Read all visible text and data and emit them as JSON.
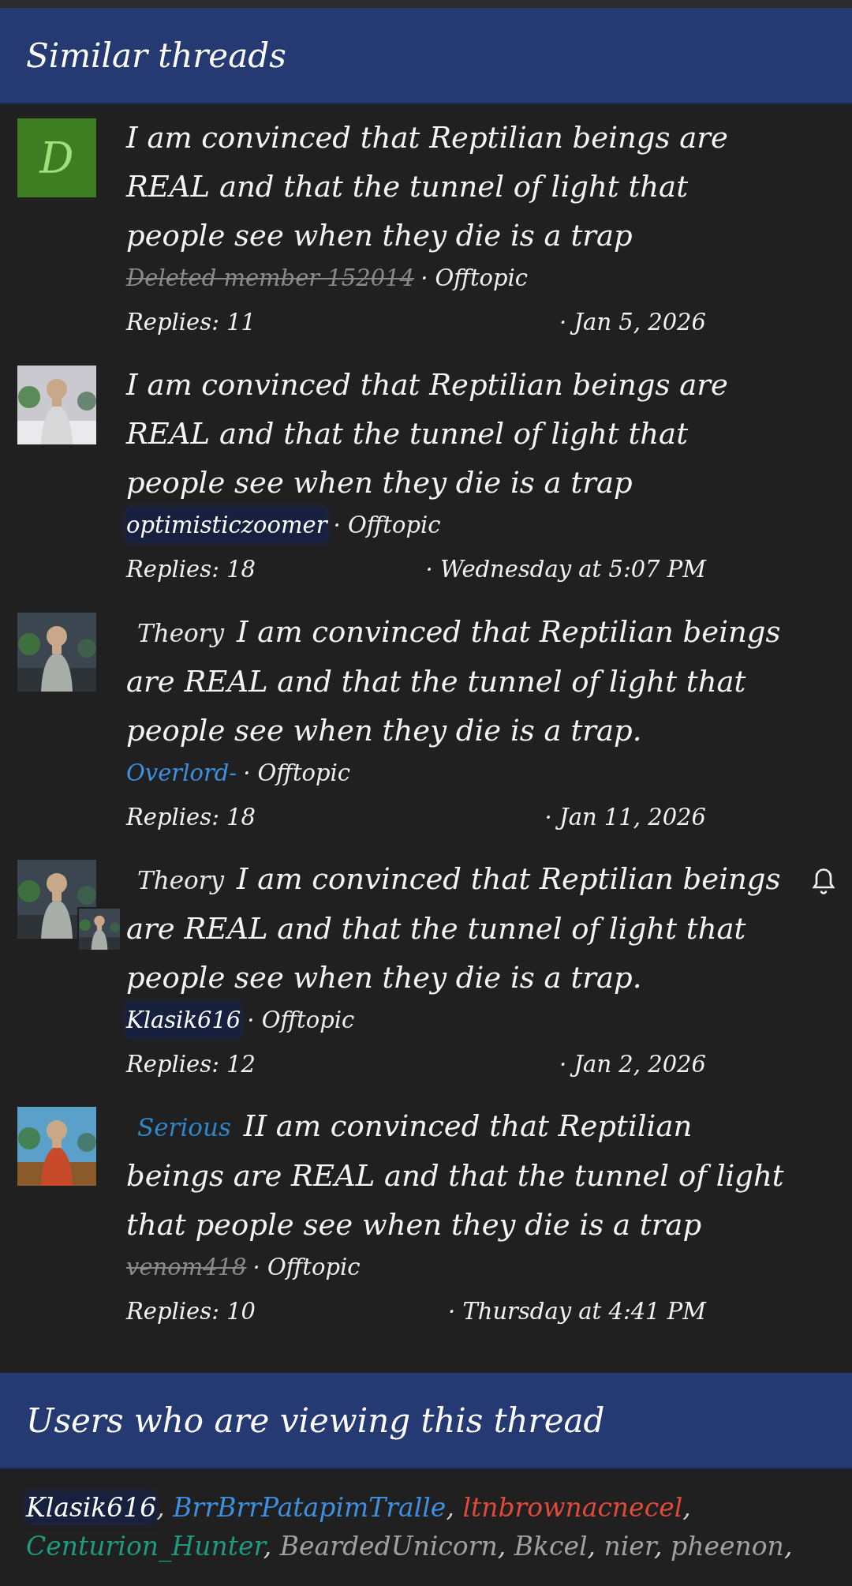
{
  "similar_threads": {
    "title": "Similar threads",
    "threads": [
      {
        "avatar": {
          "kind": "letter",
          "letter": "D",
          "color": "#3f7d23"
        },
        "title": "I am convinced that Reptilian beings are REAL and that the tunnel of light that people see when they die is a trap",
        "author": {
          "name": "Deleted member 152014",
          "kind": "deleted"
        },
        "forum": "· Offtopic",
        "replies": "Replies: 11",
        "date": "· Jan 5, 2026",
        "watched": false
      },
      {
        "title": "I am convinced that Reptilian beings are REAL and that the tunnel of light that people see when they die is a trap",
        "author": {
          "name": "optimisticzoomer",
          "kind": "highlighted"
        },
        "forum": "· Offtopic",
        "replies": "Replies: 18",
        "date": "· Wednesday at 5:07 PM",
        "watched": false
      },
      {
        "prefix": {
          "text": "Theory",
          "color": "#e8e8e8"
        },
        "title": "I am convinced that Reptilian beings are REAL and that the tunnel of light that people see when they die is a trap.",
        "author": {
          "name": "Overlord-",
          "kind": "colored",
          "color": "#3d8fe0"
        },
        "forum": "· Offtopic",
        "replies": "Replies: 18",
        "date": "· Jan 11, 2026",
        "watched": false
      },
      {
        "avatar": {
          "kind": "picture_pair"
        },
        "prefix": {
          "text": "Theory",
          "color": "#e8e8e8"
        },
        "title": "I am convinced that Reptilian beings are REAL and that the tunnel of light that people see when they die is a trap.",
        "author": {
          "name": "Klasik616",
          "kind": "highlighted"
        },
        "forum": "· Offtopic",
        "replies": "Replies: 12",
        "date": "· Jan 2, 2026",
        "watched": true
      },
      {
        "prefix": {
          "text": "Serious",
          "color": "#2f86c8"
        },
        "title": "II am convinced that Reptilian beings are REAL and that the tunnel of light that people see when they die is a trap",
        "author": {
          "name": "venom418",
          "kind": "deleted"
        },
        "forum": "· Offtopic",
        "replies": "Replies: 10",
        "date": "· Thursday at 4:41 PM",
        "watched": false
      }
    ]
  },
  "viewers": {
    "title": "Users who are viewing this thread",
    "users": [
      {
        "name": "Klasik616",
        "color": "#ffffff",
        "highlighted": true,
        "separator": ","
      },
      {
        "name": "BrrBrrPatapimTralle",
        "color": "#3d8fe0",
        "highlighted": false,
        "separator": ","
      },
      {
        "name": "ltnbrownacnecel",
        "color": "#e04a3a",
        "highlighted": false,
        "separator": ","
      },
      {
        "name": "Centurion_Hunter",
        "color": "#1f9a80",
        "highlighted": false,
        "separator": ","
      },
      {
        "name": "BeardedUnicorn",
        "color": "#a0a0a0",
        "highlighted": false,
        "separator": ","
      },
      {
        "name": "Bkcel",
        "color": "#a0a0a0",
        "highlighted": false,
        "separator": ","
      },
      {
        "name": "nier",
        "color": "#a0a0a0",
        "highlighted": false,
        "separator": ","
      },
      {
        "name": "pheenon",
        "color": "#a0a0a0",
        "highlighted": false,
        "separator": ","
      }
    ]
  }
}
